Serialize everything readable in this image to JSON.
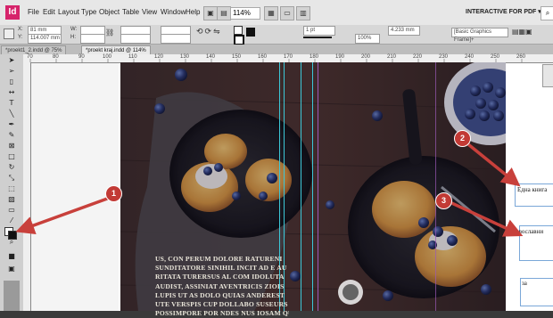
{
  "app": {
    "logo": "Id",
    "menu": [
      "File",
      "Edit",
      "Layout",
      "Type",
      "Object",
      "Table",
      "View",
      "Window",
      "Help"
    ],
    "zoom": "114%",
    "workspace": "INTERACTIVE FOR PDF",
    "workspace_arrow": "▾"
  },
  "control": {
    "x_label": "X:",
    "y_label": "Y:",
    "w_label": "W:",
    "h_label": "H:",
    "x_value": "81 mm",
    "y_value": "114.007 mm",
    "stroke_weight": "1 pt",
    "opacity": "100%",
    "size_value": "4.233 mm",
    "frame_style": "[Basic Graphics Frame]+"
  },
  "tabs": [
    {
      "label": "*proekt1_2.indd @ 75%"
    },
    {
      "label": "*proekt kraj.indd @ 114%"
    }
  ],
  "ruler": {
    "numbers": [
      "70",
      "80",
      "90",
      "100",
      "110",
      "120",
      "130",
      "140",
      "150",
      "160",
      "170",
      "180",
      "190",
      "200",
      "210",
      "220",
      "230",
      "240",
      "250",
      "260"
    ]
  },
  "callouts": [
    "1",
    "2",
    "3"
  ],
  "fields": {
    "field1": "Една книга",
    "field2": "Православни",
    "field3": "за"
  },
  "body_text": [
    "US, CON PERUM DOLORE RATURENI",
    "SUNDITATORE SINIHIL INCIT AD E AU",
    "RITATA TURERSUS AL COM IDOLUTA",
    "AUDIST, ASSINIAT AVENTRICIS ZIOIS",
    "LUPIS UT AS DOLO QUIAS ANDEREST",
    "UTE VERSPIS CUP DOLLABO SUSEURS",
    "POSSIMPORE POR NDES NUS IOSAM QU"
  ],
  "colors": {
    "callout": "#c23a35",
    "arrow": "#c8403b",
    "guide_cyan": "#3cc8d8",
    "guide_purple": "#9b59b6"
  }
}
